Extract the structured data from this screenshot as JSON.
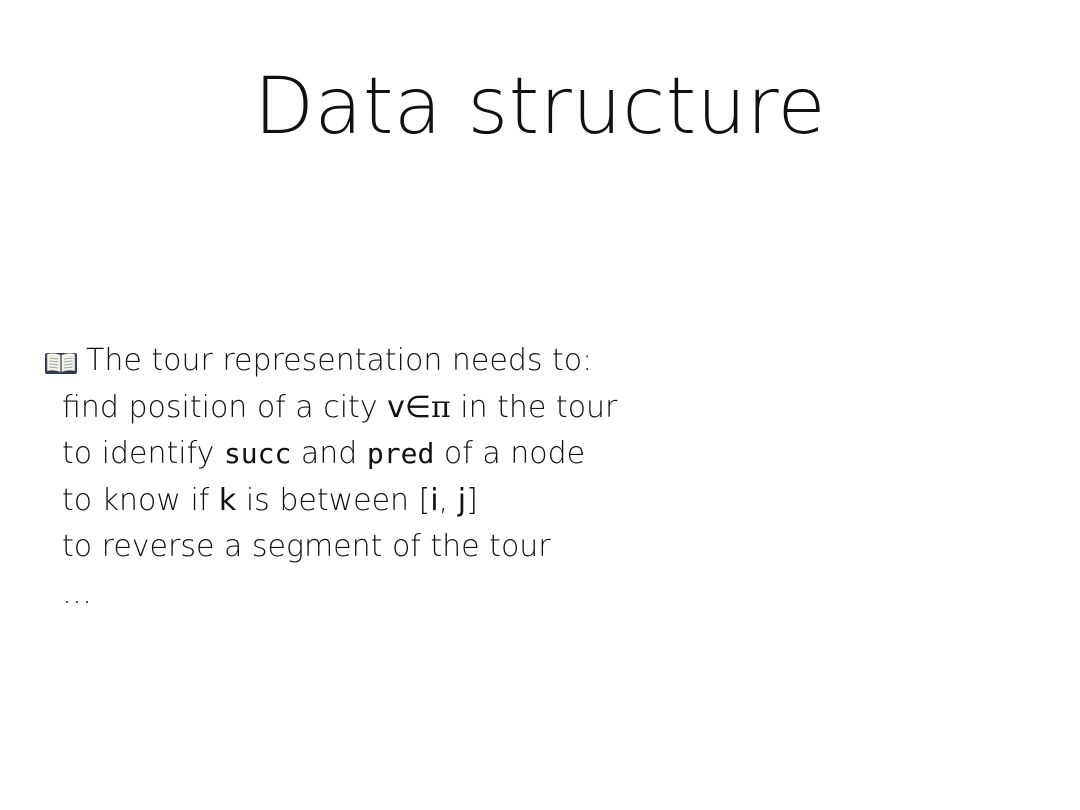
{
  "slide": {
    "title": "Data structure",
    "intro": "The tour representation needs to:",
    "items": {
      "i0": {
        "a": "find position of a city ",
        "v": "v",
        "in": "∈",
        "pi": "π",
        "b": " in the tour"
      },
      "i1": {
        "a": "to identify ",
        "succ": "succ",
        "mid": " and ",
        "pred": "pred",
        "b": " of a node"
      },
      "i2": {
        "a": "to know if ",
        "k": "k",
        "mid": " is between [",
        "i": "i",
        "comma": ", ",
        "j": "j",
        "end": "]"
      },
      "i3": {
        "a": "to reverse a segment of the tour"
      },
      "i4": {
        "a": "…"
      }
    },
    "icon": "open-book-icon"
  }
}
